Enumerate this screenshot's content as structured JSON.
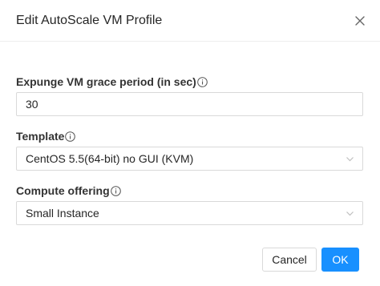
{
  "dialog": {
    "title": "Edit AutoScale VM Profile",
    "close_icon": "close-icon"
  },
  "form": {
    "expunge": {
      "label": "Expunge VM grace period (in sec)",
      "info_icon": "info-circle-icon",
      "value": "30"
    },
    "template": {
      "label": "Template",
      "info_icon": "info-circle-icon",
      "selected": "CentOS 5.5(64-bit) no GUI (KVM)"
    },
    "compute_offering": {
      "label": "Compute offering",
      "info_icon": "info-circle-icon",
      "selected": "Small Instance"
    }
  },
  "footer": {
    "cancel_label": "Cancel",
    "ok_label": "OK"
  },
  "colors": {
    "primary": "#1890ff",
    "border": "#d9d9d9",
    "text": "#262626"
  }
}
